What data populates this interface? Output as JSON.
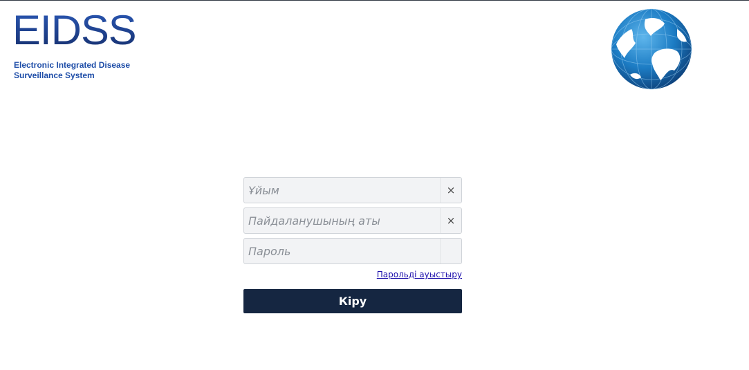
{
  "brand": {
    "logo_text": "EIDSS",
    "subtitle_line1": "Electronic Integrated Disease",
    "subtitle_line2": "Surveillance System",
    "globe_icon": "globe-icon",
    "colors": {
      "logo": "#1b3f8b",
      "subtitle": "#1f4ea8"
    }
  },
  "login": {
    "organization": {
      "placeholder": "Ұйым",
      "value": "",
      "clear_icon": "×"
    },
    "username": {
      "placeholder": "Пайдаланушының аты",
      "value": "",
      "clear_icon": "×"
    },
    "password": {
      "placeholder": "Пароль",
      "value": ""
    },
    "change_password_label": "Парольді ауыстыру",
    "submit_label": "Кіру",
    "colors": {
      "button": "#152641",
      "link": "#1a0dab"
    }
  }
}
